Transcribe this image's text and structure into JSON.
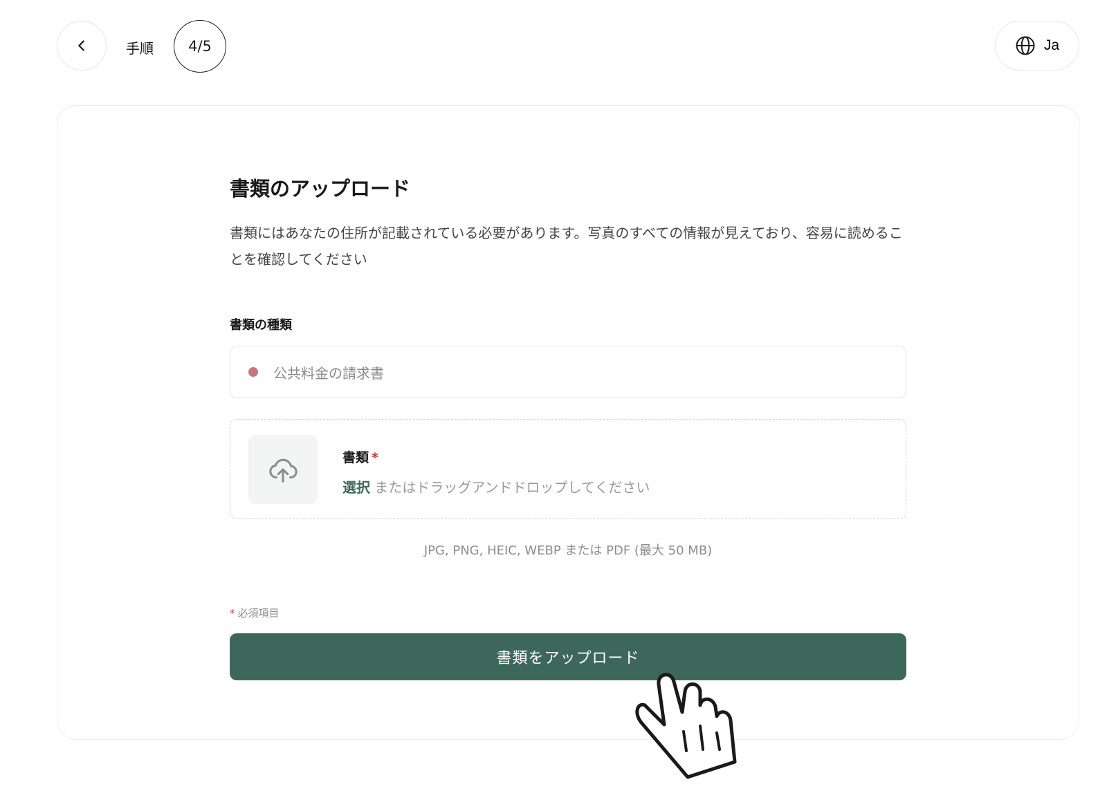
{
  "header": {
    "step_label": "手順",
    "step_count": "4/5",
    "language": "Ja"
  },
  "card": {
    "title": "書類のアップロード",
    "description": "書類にはあなたの住所が記載されている必要があります。写真のすべての情報が見えており、容易に読めることを確認してください",
    "document_type_label": "書類の種類",
    "document_type_value": "公共料金の請求書",
    "dropzone": {
      "label": "書類",
      "required_marker": "*",
      "select_link": "選択",
      "hint": "またはドラッグアンドドロップしてください"
    },
    "formats_note": "JPG, PNG, HEIC, WEBP または PDF (最大 50 MB)",
    "required_note": "必須項目",
    "required_marker": "*",
    "submit_label": "書類をアップロード"
  },
  "colors": {
    "accent": "#3e675c",
    "required": "#c23b3b",
    "status_dot": "#c7767a"
  },
  "icons": {
    "back": "chevron-left-icon",
    "language": "globe-icon",
    "upload": "cloud-upload-icon",
    "pointer": "hand-pointer-icon"
  }
}
